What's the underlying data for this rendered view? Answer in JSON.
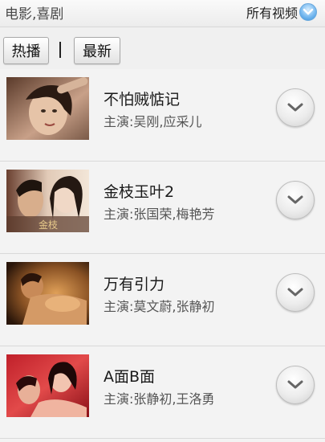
{
  "header": {
    "category": "电影,喜剧",
    "filter_label": "所有视频",
    "filter_icon": "chevron-down-icon"
  },
  "tabs": [
    {
      "label": "热播"
    },
    {
      "label": "最新"
    }
  ],
  "videos": [
    {
      "title": "不怕贼惦记",
      "actors": "主演:吴刚,应采儿"
    },
    {
      "title": "金枝玉叶2",
      "actors": "主演:张国荣,梅艳芳"
    },
    {
      "title": "万有引力",
      "actors": "主演:莫文蔚,张静初"
    },
    {
      "title": "A面B面",
      "actors": "主演:张静初,王洛勇"
    }
  ],
  "colors": {
    "accent_blue": "#3a8fd6",
    "text_dark": "#1a1a1a",
    "text_muted": "#555555"
  }
}
